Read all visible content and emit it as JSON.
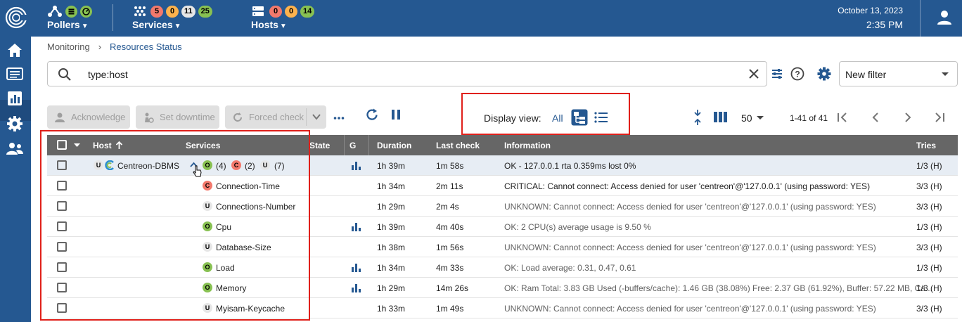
{
  "header": {
    "pollers": {
      "label": "Pollers"
    },
    "services": {
      "label": "Services",
      "counts": [
        "5",
        "0",
        "11",
        "25"
      ]
    },
    "hosts": {
      "label": "Hosts",
      "counts": [
        "0",
        "0",
        "14"
      ]
    },
    "date": "October 13, 2023",
    "time": "2:35 PM"
  },
  "breadcrumb": {
    "parent": "Monitoring",
    "current": "Resources Status"
  },
  "search": {
    "value": "type:host"
  },
  "filter": {
    "selected": "New filter"
  },
  "actions": {
    "acknowledge": "Acknowledge",
    "set_downtime": "Set downtime",
    "forced_check": "Forced check"
  },
  "display_view": {
    "label": "Display view:",
    "all": "All"
  },
  "pagination": {
    "per_page": "50",
    "info": "1-41 of 41"
  },
  "table": {
    "columns": {
      "host": "Host",
      "services": "Services",
      "state": "State",
      "graph": "G",
      "duration": "Duration",
      "last_check": "Last check",
      "information": "Information",
      "tries": "Tries"
    },
    "host_row": {
      "status": "U",
      "host": "Centreon-DBMS",
      "summary": [
        {
          "status": "O",
          "count": "(4)"
        },
        {
          "status": "C",
          "count": "(2)"
        },
        {
          "status": "U",
          "count": "(7)"
        }
      ],
      "duration": "1h 39m",
      "last_check": "1m 58s",
      "information": "OK - 127.0.0.1 rta 0.359ms lost 0%",
      "tries": "1/3 (H)"
    },
    "rows": [
      {
        "status": "C",
        "name": "Connection-Time",
        "graph": false,
        "duration": "1h 34m",
        "last_check": "2m 11s",
        "information": "CRITICAL: Cannot connect: Access denied for user 'centreon'@'127.0.0.1' (using password: YES)",
        "tries": "3/3 (H)"
      },
      {
        "status": "U",
        "name": "Connections-Number",
        "graph": false,
        "duration": "1h 29m",
        "last_check": "2m 4s",
        "information": "UNKNOWN: Cannot connect: Access denied for user 'centreon'@'127.0.0.1' (using password: YES)",
        "tries": "3/3 (H)"
      },
      {
        "status": "O",
        "name": "Cpu",
        "graph": true,
        "duration": "1h 39m",
        "last_check": "4m 40s",
        "information": "OK: 2 CPU(s) average usage is 9.50 %",
        "tries": "1/3 (H)"
      },
      {
        "status": "U",
        "name": "Database-Size",
        "graph": false,
        "duration": "1h 38m",
        "last_check": "1m 56s",
        "information": "UNKNOWN: Cannot connect: Access denied for user 'centreon'@'127.0.0.1' (using password: YES)",
        "tries": "3/3 (H)"
      },
      {
        "status": "O",
        "name": "Load",
        "graph": true,
        "duration": "1h 34m",
        "last_check": "4m 33s",
        "information": "OK: Load average: 0.31, 0.47, 0.61",
        "tries": "1/3 (H)"
      },
      {
        "status": "O",
        "name": "Memory",
        "graph": true,
        "duration": "1h 29m",
        "last_check": "14m 26s",
        "information": "OK: Ram Total: 3.83 GB Used (-buffers/cache): 1.46 GB (38.08%) Free: 2.37 GB (61.92%), Buffer: 57.22 MB, Ca...",
        "tries": "1/3 (H)"
      },
      {
        "status": "U",
        "name": "Myisam-Keycache",
        "graph": false,
        "duration": "1h 33m",
        "last_check": "1m 49s",
        "information": "UNKNOWN: Cannot connect: Access denied for user 'centreon'@'127.0.0.1' (using password: YES)",
        "tries": "3/3 (H)"
      }
    ]
  },
  "colors": {
    "header_bg": "#255891",
    "accent": "#255891",
    "ok": "#88c152",
    "critical": "#f3796c",
    "warning": "#fdb24d",
    "unknown": "#e6e6e6",
    "highlight_box": "#e0201a"
  },
  "icons": {
    "logo": "centreon-logo-icon",
    "pollers": "pollers-icon",
    "services": "services-icon",
    "hosts": "hosts-icon",
    "user": "user-icon",
    "nav": [
      "home-icon",
      "monitoring-icon",
      "reporting-icon",
      "configuration-icon",
      "administration-icon"
    ]
  }
}
